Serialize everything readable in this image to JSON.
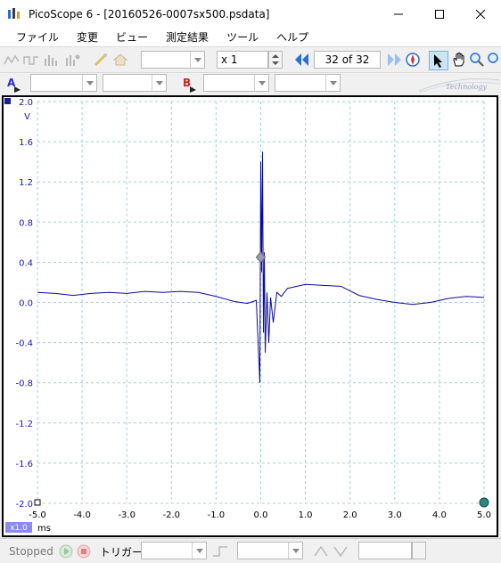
{
  "window": {
    "title": "PicoScope 6 - [20160526-0007sx500.psdata]"
  },
  "menu": {
    "items": [
      "ファイル",
      "変更",
      "ビュー",
      "測定結果",
      "ツール",
      "ヘルプ"
    ]
  },
  "toolbar": {
    "zoom_value": "x 1",
    "buffer_position": "32 of 32"
  },
  "channels": {
    "a_label": "A",
    "b_label": "B",
    "logo_text": "Technology"
  },
  "chart_data": {
    "type": "line",
    "y_unit": "V",
    "x_unit": "ms",
    "xlim": [
      -5.0,
      5.0
    ],
    "ylim": [
      -2.0,
      2.0
    ],
    "x_ticks": [
      "-5.0",
      "-4.0",
      "-3.0",
      "-2.0",
      "-1.0",
      "0.0",
      "1.0",
      "2.0",
      "3.0",
      "4.0",
      "5.0"
    ],
    "y_ticks": [
      "2.0",
      "1.6",
      "1.2",
      "0.8",
      "0.4",
      "0.0",
      "-0.4",
      "-0.8",
      "-1.2",
      "-1.6",
      "-2.0"
    ],
    "grid": true,
    "zoom_badge": "x1.0",
    "series": [
      {
        "color": "#0a0aa0",
        "x": [
          -5.0,
          -4.6,
          -4.2,
          -3.8,
          -3.4,
          -3.0,
          -2.6,
          -2.2,
          -1.8,
          -1.4,
          -1.0,
          -0.6,
          -0.3,
          -0.1,
          -0.04,
          -0.02,
          0.0,
          0.02,
          0.04,
          0.06,
          0.08,
          0.1,
          0.14,
          0.18,
          0.22,
          0.28,
          0.36,
          0.46,
          0.6,
          0.8,
          1.0,
          1.4,
          1.8,
          2.2,
          2.6,
          3.0,
          3.4,
          3.8,
          4.2,
          4.6,
          5.0
        ],
        "y": [
          0.1,
          0.09,
          0.07,
          0.09,
          0.1,
          0.09,
          0.11,
          0.1,
          0.11,
          0.1,
          0.06,
          0.01,
          -0.01,
          0.02,
          -0.6,
          -0.8,
          1.4,
          0.3,
          1.5,
          -0.3,
          0.5,
          -0.5,
          0.1,
          -0.4,
          0.05,
          -0.2,
          0.1,
          0.06,
          0.14,
          0.16,
          0.18,
          0.17,
          0.16,
          0.07,
          0.03,
          0.0,
          -0.02,
          0.0,
          0.04,
          0.06,
          0.05
        ]
      }
    ]
  }
}
